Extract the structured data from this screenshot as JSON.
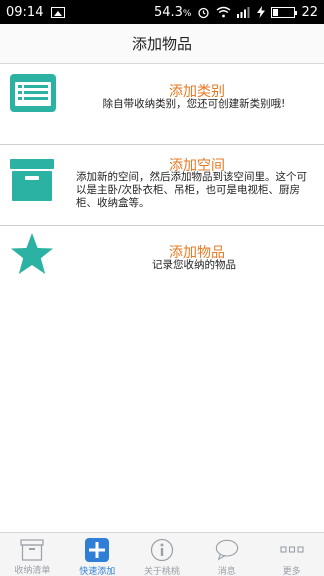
{
  "status_bar": {
    "time": "09:14",
    "battery_pct": "54.3",
    "battery_unit": "%",
    "battery_right": "22"
  },
  "header": {
    "title": "添加物品"
  },
  "rows": [
    {
      "title": "添加类别",
      "desc": "除自带收纳类别，您还可创建新类别哦!",
      "icon": "list-card-icon"
    },
    {
      "title": "添加空间",
      "desc": "添加新的空间，然后添加物品到该空间里。这个可以是主卧/次卧衣柜、吊柜，也可是电视柜、厨房柜、收纳盒等。",
      "icon": "storage-box-icon"
    },
    {
      "title": "添加物品",
      "desc": "记录您收纳的物品",
      "icon": "star-icon"
    }
  ],
  "tabs": [
    {
      "label": "收纳清单",
      "icon": "archive-box-icon"
    },
    {
      "label": "快速添加",
      "icon": "plus-square-icon",
      "active": true
    },
    {
      "label": "关于桃桃",
      "icon": "info-circle-icon"
    },
    {
      "label": "消息",
      "icon": "chat-bubble-icon"
    },
    {
      "label": "更多",
      "icon": "more-dots-icon"
    }
  ],
  "colors": {
    "accent_teal": "#2bb2a3",
    "title_orange": "#e87a24",
    "tab_active": "#2f7fd6",
    "tab_inactive": "#9aa0a8"
  }
}
